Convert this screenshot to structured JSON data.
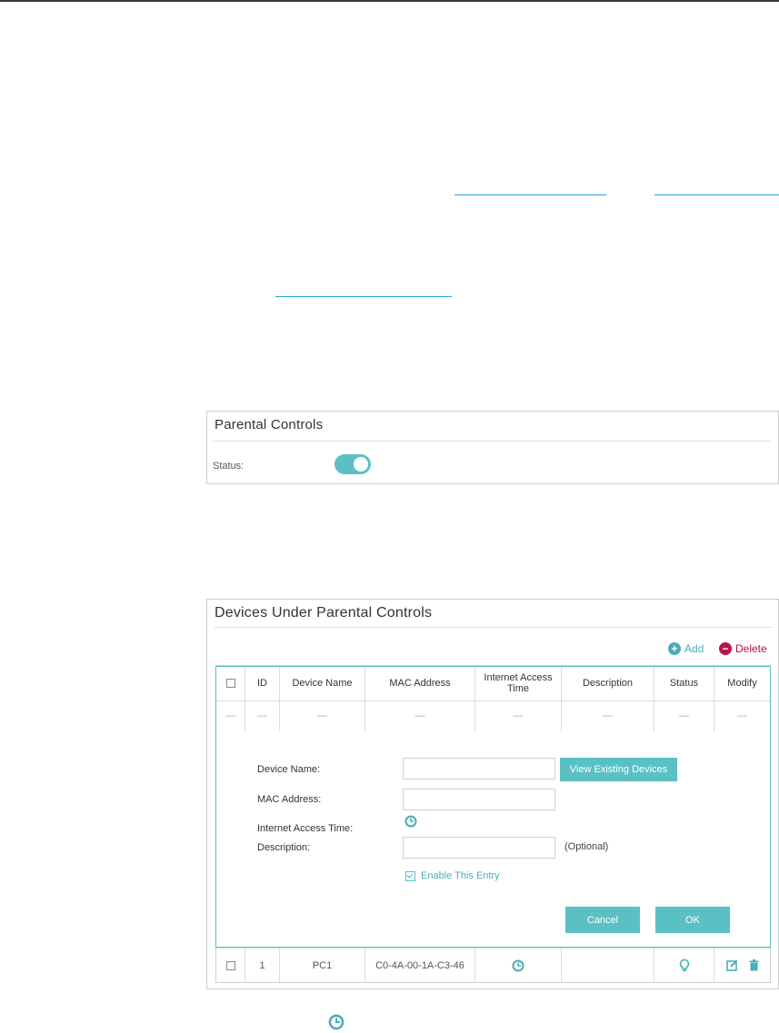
{
  "parental_panel": {
    "title": "Parental Controls",
    "status_label": "Status:",
    "toggle_on": true
  },
  "devices_panel": {
    "title": "Devices Under Parental Controls",
    "add_label": "Add",
    "delete_label": "Delete",
    "columns": [
      "ID",
      "Device Name",
      "MAC Address",
      "Internet Access Time",
      "Description",
      "Status",
      "Modify"
    ],
    "placeholder_row": [
      "—",
      "—",
      "—",
      "—",
      "—",
      "—",
      "—",
      "—"
    ],
    "form": {
      "device_name_label": "Device Name:",
      "view_existing_label": "View Existing Devices",
      "mac_label": "MAC Address:",
      "access_time_label": "Internet Access Time:",
      "description_label": "Description:",
      "optional_label": "(Optional)",
      "enable_label": "Enable This Entry",
      "cancel_label": "Cancel",
      "ok_label": "OK",
      "device_name_value": "",
      "mac_value": "",
      "description_value": ""
    },
    "rows": [
      {
        "id": "1",
        "device_name": "PC1",
        "mac": "C0-4A-00-1A-C3-46",
        "description": ""
      }
    ]
  },
  "colors": {
    "accent": "#5bc0c4",
    "accent_text": "#4aaeb5",
    "delete": "#b8124a"
  },
  "icons": [
    "clock-icon",
    "lightbulb-icon",
    "edit-icon",
    "trash-icon",
    "plus-circle-icon",
    "minus-circle-icon"
  ]
}
